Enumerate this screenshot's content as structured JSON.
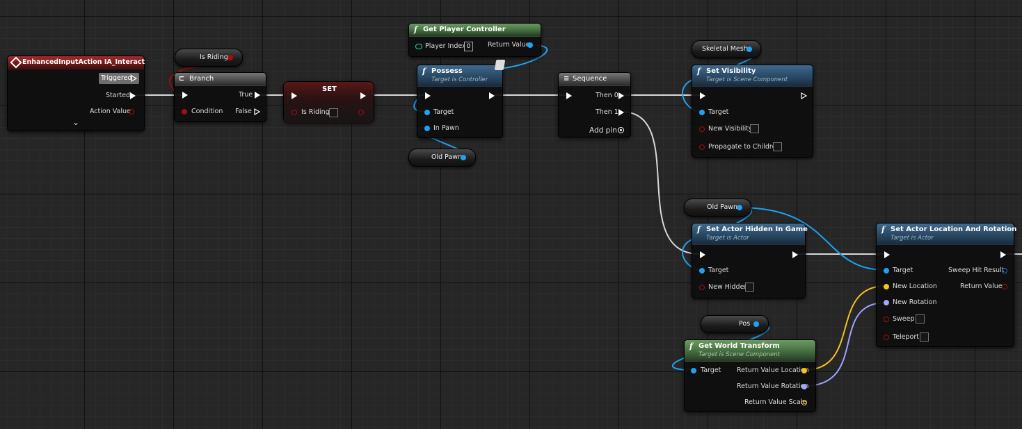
{
  "colors": {
    "exec": "#ffffff",
    "object": "#1ea3f2",
    "bool": "#a30e0e",
    "struct_hit": "#1f6fd8",
    "vector": "#f6c21b",
    "rotator": "#9ea6ff",
    "scale": "#f6c21b",
    "pure_header": "#4b7646",
    "func_header": "#2c4e6c",
    "event_header": "#7d1e1e"
  },
  "nodes": {
    "event": {
      "title": "EnhancedInputAction IA_Interact",
      "triggered": "Triggered",
      "started": "Started",
      "action_value": "Action Value",
      "expand": "⌄"
    },
    "is_riding_get": {
      "label": "Is Riding"
    },
    "branch": {
      "title": "Branch",
      "condition": "Condition",
      "true_pin": "True",
      "false_pin": "False"
    },
    "set": {
      "title": "SET",
      "is_riding": "Is Riding"
    },
    "get_player_controller": {
      "title": "Get Player Controller",
      "player_index": "Player Index",
      "player_index_value": "0",
      "return_value": "Return Value"
    },
    "possess": {
      "title": "Possess",
      "subtitle": "Target is Controller",
      "target": "Target",
      "in_pawn": "In Pawn"
    },
    "old_pawn_1": {
      "label": "Old Pawn"
    },
    "sequence": {
      "title": "Sequence",
      "then0": "Then 0",
      "then1": "Then 1",
      "add_pin": "Add pin"
    },
    "skeletal_mesh": {
      "label": "Skeletal Mesh"
    },
    "set_visibility": {
      "title": "Set Visibility",
      "subtitle": "Target is Scene Component",
      "target": "Target",
      "new_visibility": "New Visibility",
      "propagate": "Propagate to Children"
    },
    "old_pawn_2": {
      "label": "Old Pawn"
    },
    "set_hidden": {
      "title": "Set Actor Hidden In Game",
      "subtitle": "Target is Actor",
      "target": "Target",
      "new_hidden": "New Hidden"
    },
    "set_loc_rot": {
      "title": "Set Actor Location And Rotation",
      "subtitle": "Target is Actor",
      "target": "Target",
      "new_location": "New Location",
      "new_rotation": "New Rotation",
      "sweep": "Sweep",
      "teleport": "Teleport",
      "sweep_hit": "Sweep Hit Result",
      "return_value": "Return Value"
    },
    "pos": {
      "label": "Pos"
    },
    "get_world_transform": {
      "title": "Get World Transform",
      "subtitle": "Target is Scene Component",
      "target": "Target",
      "rv_location": "Return Value Location",
      "rv_rotation": "Return Value Rotation",
      "rv_scale": "Return Value Scale"
    }
  },
  "icons": {
    "function": "f",
    "event": "event-diamond-icon",
    "branch": "branch-icon",
    "sequence": "sequence-icon",
    "add_pin": "add-pin-icon",
    "latent": "latent-clock-icon"
  }
}
